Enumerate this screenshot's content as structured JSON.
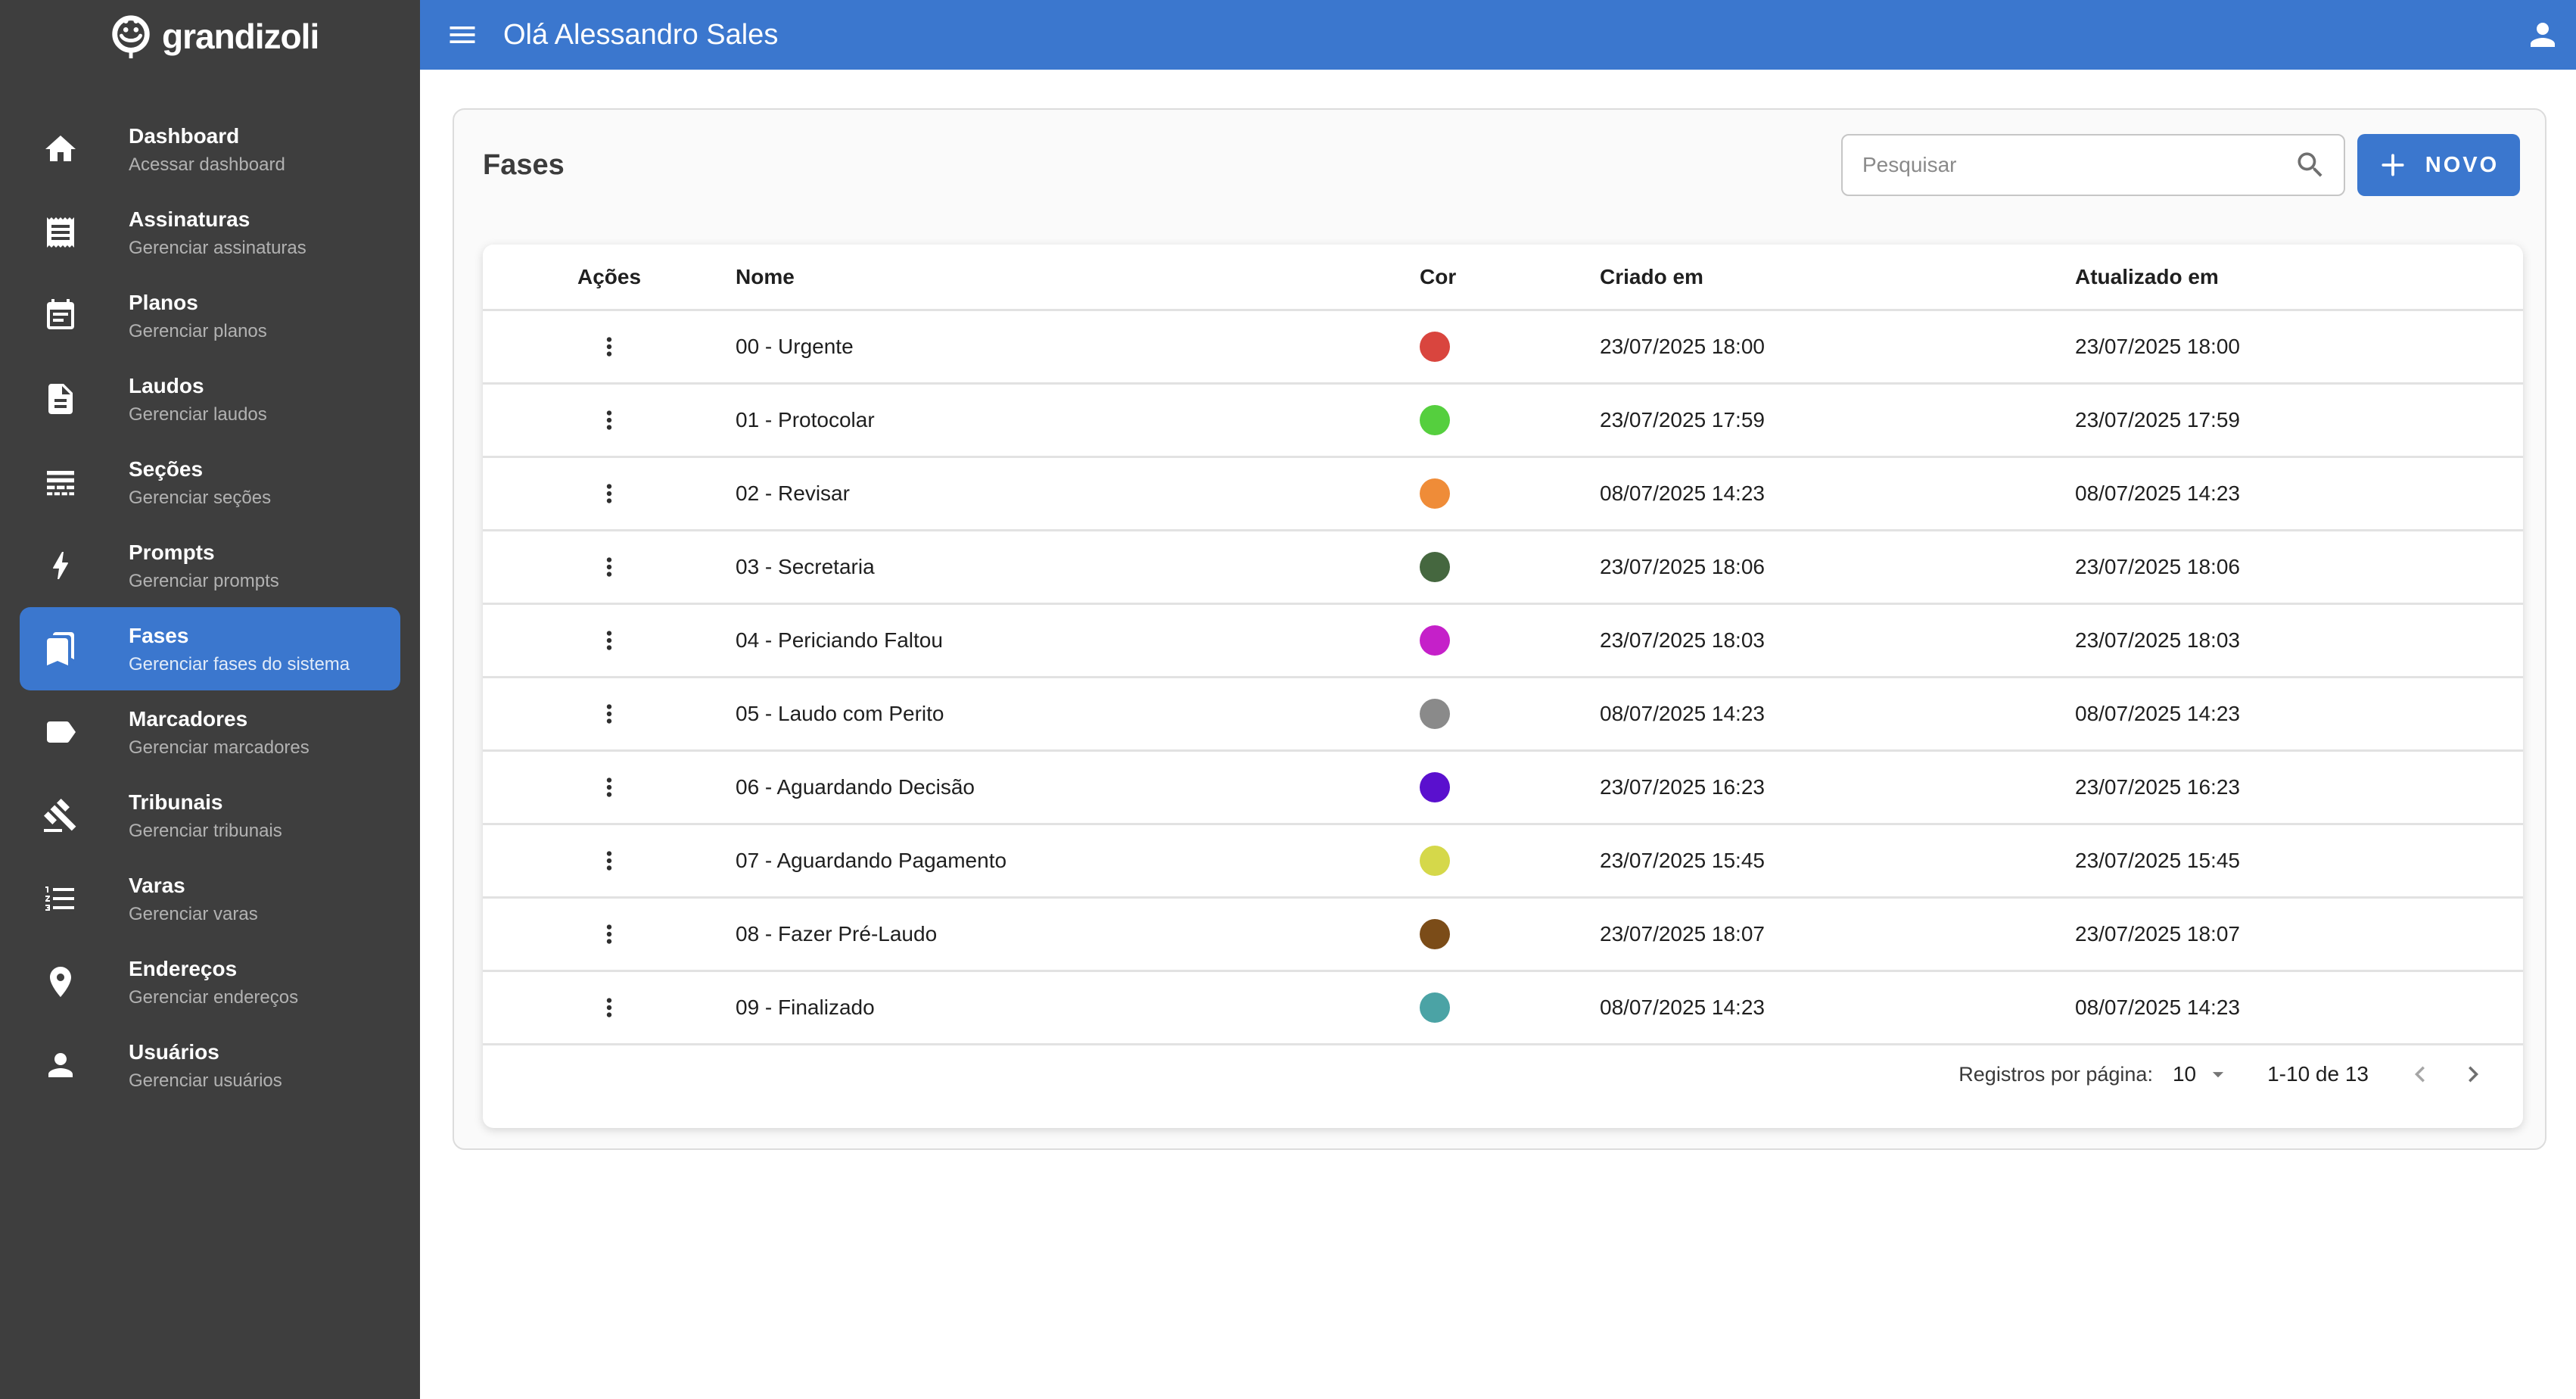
{
  "brand": {
    "name": "grandizoli",
    "logo_icon": "mascot-logo-icon"
  },
  "topbar": {
    "title": "Olá Alessandro Sales",
    "menu_icon": "hamburger-icon",
    "user_icon": "user-icon"
  },
  "sidebar": {
    "items": [
      {
        "label": "Dashboard",
        "sublabel": "Acessar dashboard",
        "icon": "home-icon",
        "active": false
      },
      {
        "label": "Assinaturas",
        "sublabel": "Gerenciar assinaturas",
        "icon": "receipt-icon",
        "active": false
      },
      {
        "label": "Planos",
        "sublabel": "Gerenciar planos",
        "icon": "calendar-icon",
        "active": false
      },
      {
        "label": "Laudos",
        "sublabel": "Gerenciar laudos",
        "icon": "document-icon",
        "active": false
      },
      {
        "label": "Seções",
        "sublabel": "Gerenciar seções",
        "icon": "sections-icon",
        "active": false
      },
      {
        "label": "Prompts",
        "sublabel": "Gerenciar prompts",
        "icon": "bolt-icon",
        "active": false
      },
      {
        "label": "Fases",
        "sublabel": "Gerenciar fases do sistema",
        "icon": "bookmarks-icon",
        "active": true
      },
      {
        "label": "Marcadores",
        "sublabel": "Gerenciar marcadores",
        "icon": "label-icon",
        "active": false
      },
      {
        "label": "Tribunais",
        "sublabel": "Gerenciar tribunais",
        "icon": "gavel-icon",
        "active": false
      },
      {
        "label": "Varas",
        "sublabel": "Gerenciar varas",
        "icon": "numbered-list-icon",
        "active": false
      },
      {
        "label": "Endereços",
        "sublabel": "Gerenciar endereços",
        "icon": "location-pin-icon",
        "active": false
      },
      {
        "label": "Usuários",
        "sublabel": "Gerenciar usuários",
        "icon": "person-icon",
        "active": false
      }
    ]
  },
  "page": {
    "title": "Fases",
    "search": {
      "placeholder": "Pesquisar",
      "icon": "search-icon"
    },
    "new_button": {
      "label": "NOVO",
      "icon": "plus-icon"
    }
  },
  "table": {
    "headers": [
      "Ações",
      "Nome",
      "Cor",
      "Criado em",
      "Atualizado em"
    ],
    "row_action_icon": "kebab-menu-icon",
    "rows": [
      {
        "name": "00 - Urgente",
        "color": "#D9453E",
        "created": "23/07/2025 18:00",
        "updated": "23/07/2025 18:00"
      },
      {
        "name": "01 - Protocolar",
        "color": "#55CF3E",
        "created": "23/07/2025 17:59",
        "updated": "23/07/2025 17:59"
      },
      {
        "name": "02 - Revisar",
        "color": "#EF8C38",
        "created": "08/07/2025 14:23",
        "updated": "08/07/2025 14:23"
      },
      {
        "name": "03 - Secretaria",
        "color": "#45673F",
        "created": "23/07/2025 18:06",
        "updated": "23/07/2025 18:06"
      },
      {
        "name": "04 - Periciando Faltou",
        "color": "#C520C9",
        "created": "23/07/2025 18:03",
        "updated": "23/07/2025 18:03"
      },
      {
        "name": "05 - Laudo com Perito",
        "color": "#8A8A8A",
        "created": "08/07/2025 14:23",
        "updated": "08/07/2025 14:23"
      },
      {
        "name": "06 - Aguardando Decisão",
        "color": "#5A10CE",
        "created": "23/07/2025 16:23",
        "updated": "23/07/2025 16:23"
      },
      {
        "name": "07 - Aguardando Pagamento",
        "color": "#D5D84A",
        "created": "23/07/2025 15:45",
        "updated": "23/07/2025 15:45"
      },
      {
        "name": "08 - Fazer Pré-Laudo",
        "color": "#7B4C18",
        "created": "23/07/2025 18:07",
        "updated": "23/07/2025 18:07"
      },
      {
        "name": "09 - Finalizado",
        "color": "#4BA3A5",
        "created": "08/07/2025 14:23",
        "updated": "08/07/2025 14:23"
      }
    ]
  },
  "pagination": {
    "label": "Registros por página:",
    "per_page": "10",
    "caret_icon": "caret-down-icon",
    "range": "1-10 de 13",
    "prev_icon": "chevron-left-icon",
    "next_icon": "chevron-right-icon"
  },
  "colors": {
    "accent": "#3B77CE",
    "sidebar_bg": "#3E3E3E",
    "card_bg": "#FAFAFA",
    "row_divider": "#E2E2E2"
  }
}
